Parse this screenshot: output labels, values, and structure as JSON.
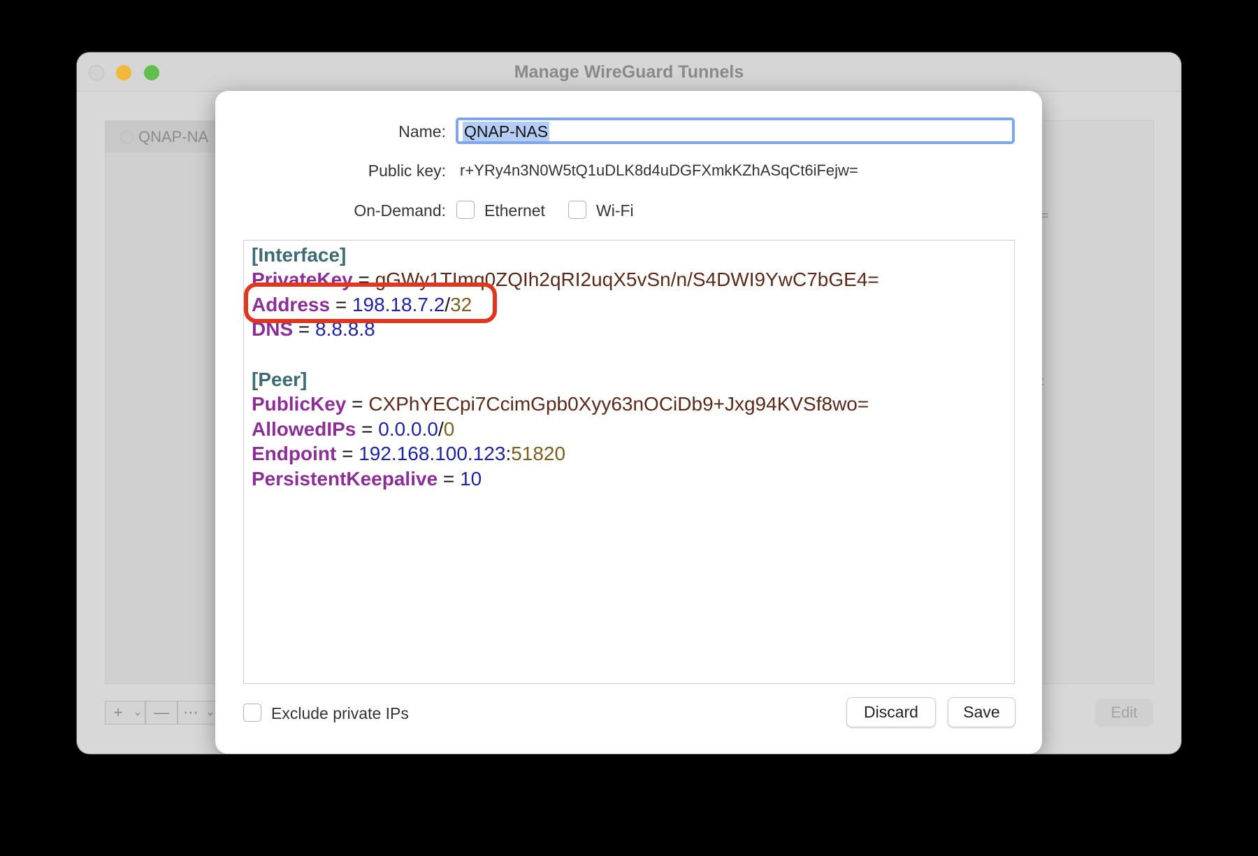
{
  "window": {
    "title": "Manage WireGuard Tunnels"
  },
  "sidebar": {
    "items": [
      {
        "label": "QNAP-NA"
      }
    ],
    "toolbar": {
      "add": "+",
      "add_menu": "⌄",
      "remove": "—",
      "more": "⋯",
      "more_menu": "⌄"
    }
  },
  "detail": {
    "marks": [
      "=",
      ":"
    ],
    "edit_label": "Edit"
  },
  "sheet": {
    "name_label": "Name:",
    "name_value": "QNAP-NAS",
    "public_key_label": "Public key:",
    "public_key_value": "r+YRy4n3N0W5tQ1uDLK8d4uDGFXmkKZhASqCt6iFejw=",
    "on_demand_label": "On-Demand:",
    "ethernet_label": "Ethernet",
    "wifi_label": "Wi-Fi",
    "exclude_private_ips_label": "Exclude private IPs",
    "discard_label": "Discard",
    "save_label": "Save"
  },
  "config": {
    "interface_header": "[Interface]",
    "private_key_key": "PrivateKey",
    "private_key_value": "gGWy1TImq0ZQIh2qRI2uqX5vSn/n/S4DWI9YwC7bGE4=",
    "address_key": "Address",
    "address_ip": "198.18.7.2",
    "address_prefix": "32",
    "dns_key": "DNS",
    "dns_value": "8.8.8.8",
    "peer_header": "[Peer]",
    "public_key_key": "PublicKey",
    "public_key_value": "CXPhYECpi7CcimGpb0Xyy63nOCiDb9+Jxg94KVSf8wo=",
    "allowed_ips_key": "AllowedIPs",
    "allowed_ips_ip": "0.0.0.0",
    "allowed_ips_prefix": "0",
    "endpoint_key": "Endpoint",
    "endpoint_host": "192.168.100.123",
    "endpoint_port": "51820",
    "keepalive_key": "PersistentKeepalive",
    "keepalive_value": "10",
    "equals": "=",
    "slash": "/",
    "colon": ":"
  },
  "colors": {
    "highlight_ring": "#e0351e",
    "section": "#3e6b73",
    "key": "#8b2f96",
    "ip": "#1e23a0",
    "number": "#7a5f1d"
  }
}
